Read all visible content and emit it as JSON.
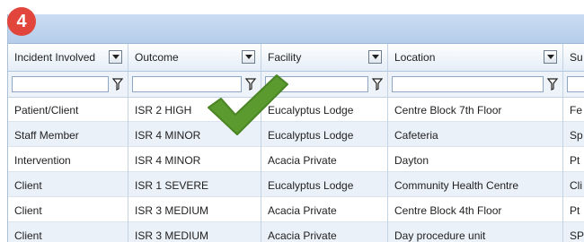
{
  "step_badge": "4",
  "grid": {
    "columns": [
      {
        "label": "Incident Involved"
      },
      {
        "label": "Outcome"
      },
      {
        "label": "Facility"
      },
      {
        "label": "Location"
      },
      {
        "label": "Su"
      }
    ],
    "filters": [
      "",
      "",
      "",
      "",
      ""
    ],
    "rows": [
      [
        "Patient/Client",
        "ISR 2 HIGH",
        "Eucalyptus Lodge",
        "Centre Block 7th Floor",
        "Fe"
      ],
      [
        "Staff Member",
        "ISR 4 MINOR",
        "Eucalyptus Lodge",
        "Cafeteria",
        "Sp"
      ],
      [
        "Intervention",
        "ISR 4 MINOR",
        "Acacia Private",
        "Dayton",
        "Pt"
      ],
      [
        "Client",
        "ISR 1 SEVERE",
        "Eucalyptus Lodge",
        "Community Health Centre",
        "Cli"
      ],
      [
        "Client",
        "ISR 3 MEDIUM",
        "Acacia Private",
        "Centre Block 4th Floor",
        "Pt"
      ],
      [
        "Client",
        "ISR 3 MEDIUM",
        "Acacia Private",
        "Day procedure unit",
        "SP"
      ]
    ]
  },
  "overlay": {
    "checkmark_icon": "checkmark-icon",
    "color": "#5a9a2e"
  }
}
